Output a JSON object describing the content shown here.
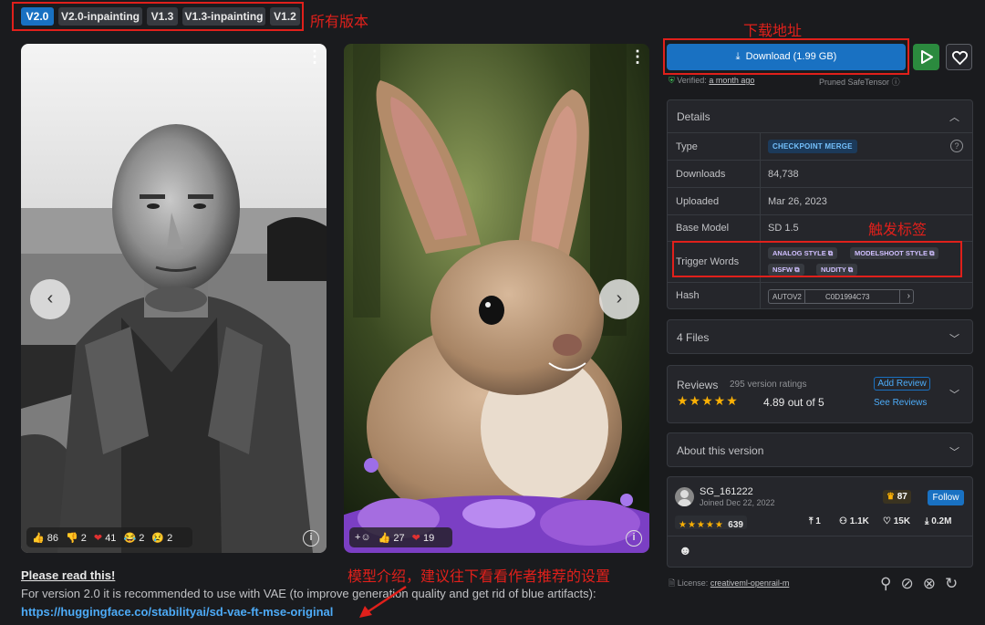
{
  "versions": [
    "V2.0",
    "V2.0-inpainting",
    "V1.3",
    "V1.3-inpainting",
    "V1.2"
  ],
  "annotations": {
    "versions": "所有版本",
    "download": "下载地址",
    "trigger": "触发标签",
    "intro": "模型介绍，建议往下看看作者推荐的设置"
  },
  "card1": {
    "reactions": [
      {
        "icon": "👍",
        "count": "86"
      },
      {
        "icon": "👎",
        "count": "2"
      },
      {
        "icon": "❤",
        "count": "41"
      },
      {
        "icon": "😂",
        "count": "2"
      },
      {
        "icon": "😢",
        "count": "2"
      }
    ]
  },
  "card2": {
    "reactions": [
      {
        "icon": "+☺",
        "count": ""
      },
      {
        "icon": "👍",
        "count": "27"
      },
      {
        "icon": "❤",
        "count": "19"
      }
    ]
  },
  "description": {
    "title": "Please read this!",
    "line": "For version 2.0 it is recommended to use with VAE (to improve generation quality and get rid of blue artifacts):",
    "link": "https://huggingface.co/stabilityai/sd-vae-ft-mse-original"
  },
  "download": {
    "label": "Download (1.99 GB)"
  },
  "verified": {
    "prefix": "Verified:",
    "when": "a month ago",
    "pruned": "Pruned SafeTensor"
  },
  "details": {
    "title": "Details",
    "type_label": "Type",
    "type_value": "CHECKPOINT MERGE",
    "downloads_label": "Downloads",
    "downloads_value": "84,738",
    "uploaded_label": "Uploaded",
    "uploaded_value": "Mar 26, 2023",
    "base_label": "Base Model",
    "base_value": "SD 1.5",
    "trigger_label": "Trigger Words",
    "trigger_words": [
      "ANALOG STYLE",
      "MODELSHOOT STYLE",
      "NSFW",
      "NUDITY"
    ],
    "hash_label": "Hash",
    "hash_type": "AUTOV2",
    "hash_value": "C0D1994C73"
  },
  "files": {
    "title": "4 Files"
  },
  "reviews": {
    "title": "Reviews",
    "ratings": "295 version ratings",
    "score": "4.89 out of 5",
    "add": "Add Review",
    "see": "See Reviews"
  },
  "about": {
    "title": "About this version"
  },
  "creator": {
    "name": "SG_161222",
    "joined": "Joined Dec 22, 2022",
    "rank": "87",
    "follow": "Follow",
    "rating_count": "639",
    "uploads": "1",
    "followers": "1.1K",
    "likes": "15K",
    "downloads": "0.2M"
  },
  "license": {
    "prefix": "License:",
    "name": "creativeml-openrail-m"
  },
  "colors": {
    "accent": "#1971c2",
    "annotation": "#e0201b",
    "star": "#fab005",
    "play": "#2b8a3e"
  }
}
